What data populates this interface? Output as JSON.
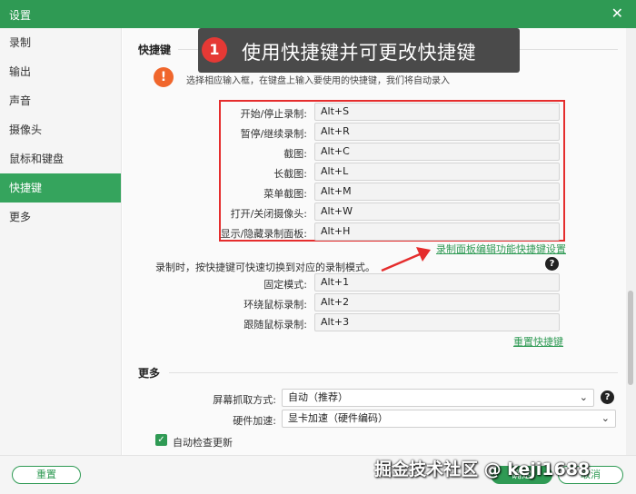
{
  "window": {
    "title": "设置"
  },
  "sidebar": {
    "items": [
      {
        "label": "录制"
      },
      {
        "label": "输出"
      },
      {
        "label": "声音"
      },
      {
        "label": "摄像头"
      },
      {
        "label": "鼠标和键盘"
      },
      {
        "label": "快捷键"
      },
      {
        "label": "更多"
      }
    ],
    "active_index": 5
  },
  "callout": {
    "number": "1",
    "text": "使用快捷键并可更改快捷键"
  },
  "shortcuts": {
    "section_title": "快捷键",
    "hint": "选择相应输入框，在键盘上输入要使用的快捷键，我们将自动录入",
    "rows": [
      {
        "label": "开始/停止录制:",
        "value": "Alt+S"
      },
      {
        "label": "暂停/继续录制:",
        "value": "Alt+R"
      },
      {
        "label": "截图:",
        "value": "Alt+C"
      },
      {
        "label": "长截图:",
        "value": "Alt+L"
      },
      {
        "label": "菜单截图:",
        "value": "Alt+M"
      },
      {
        "label": "打开/关闭摄像头:",
        "value": "Alt+W"
      },
      {
        "label": "显示/隐藏录制面板:",
        "value": "Alt+H"
      }
    ],
    "panel_link": "录制面板编辑功能快捷键设置",
    "mode_hint": "录制时，按快捷键可快速切换到对应的录制模式。",
    "mode_rows": [
      {
        "label": "固定模式:",
        "value": "Alt+1"
      },
      {
        "label": "环绕鼠标录制:",
        "value": "Alt+2"
      },
      {
        "label": "跟随鼠标录制:",
        "value": "Alt+3"
      }
    ],
    "reset_link": "重置快捷键"
  },
  "more": {
    "section_title": "更多",
    "capture_label": "屏幕抓取方式:",
    "capture_value": "自动（推荐）",
    "hw_label": "硬件加速:",
    "hw_value": "显卡加速（硬件编码）",
    "auto_update_label": "自动检查更新"
  },
  "footer": {
    "reset": "重置",
    "ok": "确定",
    "cancel": "取消"
  },
  "watermark": "掘金技术社区 @ keji1688",
  "colors": {
    "brand": "#2f9a54",
    "highlight": "#e52d2d",
    "callout_bg": "#4a4a4a"
  }
}
